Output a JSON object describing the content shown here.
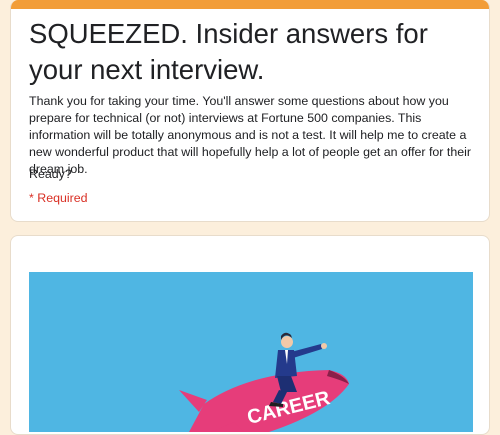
{
  "form": {
    "title": "SQUEEZED. Insider answers for your next interview.",
    "description": "Thank you for taking your time. You'll answer some questions about how you prepare for technical (or not) interviews at Fortune 500 companies. This information will be totally anonymous and is not a test. It will help me to create a new wonderful product that will hopefully help a lot of people get an offer for their dream job.",
    "ready": "Ready?",
    "required": "* Required"
  },
  "banner": {
    "rocket_text": "CAREER",
    "icon": "career-rocket-illustration"
  },
  "colors": {
    "accent": "#f29d38",
    "background": "#fcefdc",
    "required": "#d93025",
    "banner_sky": "#4fb6e3",
    "rocket": "#e63d7a"
  }
}
